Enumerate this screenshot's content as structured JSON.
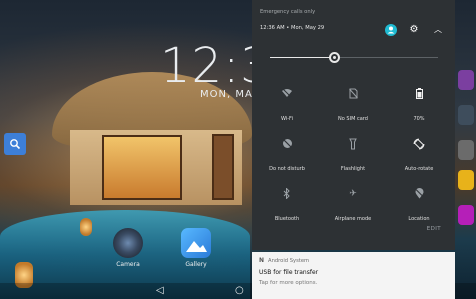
{
  "home": {
    "clock": "12:3",
    "date": "MON, MAY",
    "apps": [
      {
        "label": "Camera",
        "icon": "camera-icon"
      },
      {
        "label": "Gallery",
        "icon": "gallery-icon"
      }
    ],
    "search_icon": "search-icon"
  },
  "quick_settings": {
    "emergency_text": "Emergency calls only",
    "status_line": "12:36 AM • Mon, May 29",
    "header_icons": [
      "user-icon",
      "gear-icon",
      "collapse-icon"
    ],
    "brightness_level": 0.38,
    "tiles": [
      {
        "label": "Wi-Fi",
        "icon": "wifi-off-icon",
        "active": false
      },
      {
        "label": "No SIM card",
        "icon": "sim-off-icon",
        "active": false
      },
      {
        "label": "70%",
        "icon": "battery-icon",
        "active": true
      },
      {
        "label": "Do not disturb",
        "icon": "dnd-off-icon",
        "active": false
      },
      {
        "label": "Flashlight",
        "icon": "flashlight-icon",
        "active": false
      },
      {
        "label": "Auto-rotate",
        "icon": "auto-rotate-icon",
        "active": true
      },
      {
        "label": "Bluetooth",
        "icon": "bluetooth-off-icon",
        "active": false
      },
      {
        "label": "Airplane mode",
        "icon": "airplane-icon",
        "active": false
      },
      {
        "label": "Location",
        "icon": "location-off-icon",
        "active": false
      }
    ],
    "edit_label": "EDIT"
  },
  "notification": {
    "app_name": "Android System",
    "title": "USB for file transfer",
    "subtitle": "Tap for more options."
  },
  "nav": {
    "back": "◁",
    "home": "○"
  },
  "colors": {
    "panel_bg": "#2d3134",
    "accent": "#1fbbd2",
    "notification_bg": "#f4f4f4"
  }
}
